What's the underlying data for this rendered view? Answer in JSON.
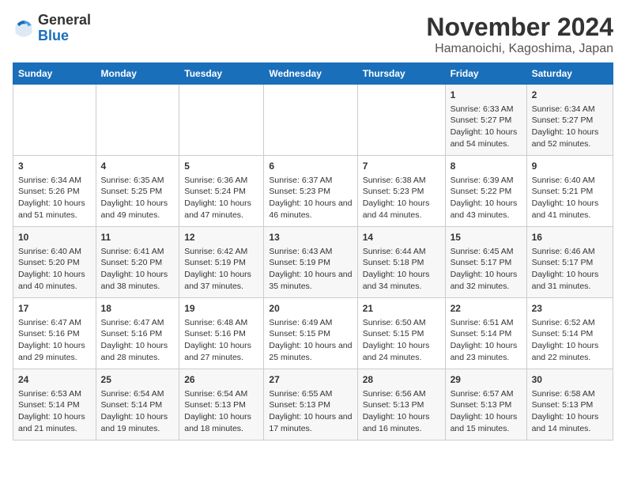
{
  "header": {
    "logo_general": "General",
    "logo_blue": "Blue",
    "title": "November 2024",
    "subtitle": "Hamanoichi, Kagoshima, Japan"
  },
  "days_of_week": [
    "Sunday",
    "Monday",
    "Tuesday",
    "Wednesday",
    "Thursday",
    "Friday",
    "Saturday"
  ],
  "weeks": [
    [
      {
        "day": "",
        "info": ""
      },
      {
        "day": "",
        "info": ""
      },
      {
        "day": "",
        "info": ""
      },
      {
        "day": "",
        "info": ""
      },
      {
        "day": "",
        "info": ""
      },
      {
        "day": "1",
        "info": "Sunrise: 6:33 AM\nSunset: 5:27 PM\nDaylight: 10 hours and 54 minutes."
      },
      {
        "day": "2",
        "info": "Sunrise: 6:34 AM\nSunset: 5:27 PM\nDaylight: 10 hours and 52 minutes."
      }
    ],
    [
      {
        "day": "3",
        "info": "Sunrise: 6:34 AM\nSunset: 5:26 PM\nDaylight: 10 hours and 51 minutes."
      },
      {
        "day": "4",
        "info": "Sunrise: 6:35 AM\nSunset: 5:25 PM\nDaylight: 10 hours and 49 minutes."
      },
      {
        "day": "5",
        "info": "Sunrise: 6:36 AM\nSunset: 5:24 PM\nDaylight: 10 hours and 47 minutes."
      },
      {
        "day": "6",
        "info": "Sunrise: 6:37 AM\nSunset: 5:23 PM\nDaylight: 10 hours and 46 minutes."
      },
      {
        "day": "7",
        "info": "Sunrise: 6:38 AM\nSunset: 5:23 PM\nDaylight: 10 hours and 44 minutes."
      },
      {
        "day": "8",
        "info": "Sunrise: 6:39 AM\nSunset: 5:22 PM\nDaylight: 10 hours and 43 minutes."
      },
      {
        "day": "9",
        "info": "Sunrise: 6:40 AM\nSunset: 5:21 PM\nDaylight: 10 hours and 41 minutes."
      }
    ],
    [
      {
        "day": "10",
        "info": "Sunrise: 6:40 AM\nSunset: 5:20 PM\nDaylight: 10 hours and 40 minutes."
      },
      {
        "day": "11",
        "info": "Sunrise: 6:41 AM\nSunset: 5:20 PM\nDaylight: 10 hours and 38 minutes."
      },
      {
        "day": "12",
        "info": "Sunrise: 6:42 AM\nSunset: 5:19 PM\nDaylight: 10 hours and 37 minutes."
      },
      {
        "day": "13",
        "info": "Sunrise: 6:43 AM\nSunset: 5:19 PM\nDaylight: 10 hours and 35 minutes."
      },
      {
        "day": "14",
        "info": "Sunrise: 6:44 AM\nSunset: 5:18 PM\nDaylight: 10 hours and 34 minutes."
      },
      {
        "day": "15",
        "info": "Sunrise: 6:45 AM\nSunset: 5:17 PM\nDaylight: 10 hours and 32 minutes."
      },
      {
        "day": "16",
        "info": "Sunrise: 6:46 AM\nSunset: 5:17 PM\nDaylight: 10 hours and 31 minutes."
      }
    ],
    [
      {
        "day": "17",
        "info": "Sunrise: 6:47 AM\nSunset: 5:16 PM\nDaylight: 10 hours and 29 minutes."
      },
      {
        "day": "18",
        "info": "Sunrise: 6:47 AM\nSunset: 5:16 PM\nDaylight: 10 hours and 28 minutes."
      },
      {
        "day": "19",
        "info": "Sunrise: 6:48 AM\nSunset: 5:16 PM\nDaylight: 10 hours and 27 minutes."
      },
      {
        "day": "20",
        "info": "Sunrise: 6:49 AM\nSunset: 5:15 PM\nDaylight: 10 hours and 25 minutes."
      },
      {
        "day": "21",
        "info": "Sunrise: 6:50 AM\nSunset: 5:15 PM\nDaylight: 10 hours and 24 minutes."
      },
      {
        "day": "22",
        "info": "Sunrise: 6:51 AM\nSunset: 5:14 PM\nDaylight: 10 hours and 23 minutes."
      },
      {
        "day": "23",
        "info": "Sunrise: 6:52 AM\nSunset: 5:14 PM\nDaylight: 10 hours and 22 minutes."
      }
    ],
    [
      {
        "day": "24",
        "info": "Sunrise: 6:53 AM\nSunset: 5:14 PM\nDaylight: 10 hours and 21 minutes."
      },
      {
        "day": "25",
        "info": "Sunrise: 6:54 AM\nSunset: 5:14 PM\nDaylight: 10 hours and 19 minutes."
      },
      {
        "day": "26",
        "info": "Sunrise: 6:54 AM\nSunset: 5:13 PM\nDaylight: 10 hours and 18 minutes."
      },
      {
        "day": "27",
        "info": "Sunrise: 6:55 AM\nSunset: 5:13 PM\nDaylight: 10 hours and 17 minutes."
      },
      {
        "day": "28",
        "info": "Sunrise: 6:56 AM\nSunset: 5:13 PM\nDaylight: 10 hours and 16 minutes."
      },
      {
        "day": "29",
        "info": "Sunrise: 6:57 AM\nSunset: 5:13 PM\nDaylight: 10 hours and 15 minutes."
      },
      {
        "day": "30",
        "info": "Sunrise: 6:58 AM\nSunset: 5:13 PM\nDaylight: 10 hours and 14 minutes."
      }
    ]
  ]
}
